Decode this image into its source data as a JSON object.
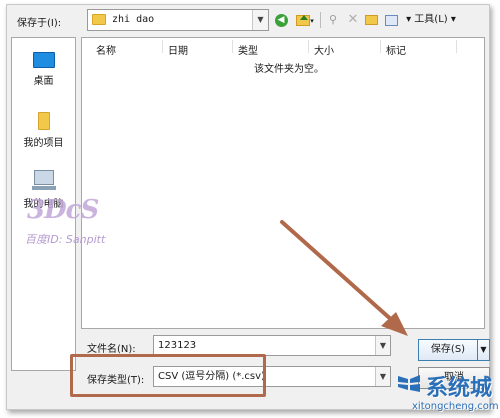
{
  "dialog": {
    "save_in_label": "保存于(I):",
    "folder_name": "zhi dao",
    "toolbar": {
      "tools_label": "▾ 工具(L) ▾"
    }
  },
  "places": [
    {
      "label": "桌面",
      "icon": "desktop-icon"
    },
    {
      "label": "我的项目",
      "icon": "folder-icon"
    },
    {
      "label": "我的电脑",
      "icon": "computer-icon"
    }
  ],
  "file_list": {
    "columns": [
      "名称",
      "日期",
      "类型",
      "大小",
      "标记"
    ],
    "empty_message": "该文件夹为空。"
  },
  "form": {
    "filename_label": "文件名(N):",
    "filename_value": "123123",
    "filetype_label": "保存类型(T):",
    "filetype_value": "CSV (逗号分隔) (*.csv)"
  },
  "buttons": {
    "save": "保存(S)",
    "cancel": "取消"
  },
  "watermarks": {
    "overlay_logo": "3DcS",
    "overlay_text": "百度ID: Sanpitt",
    "site_brand": "系统城",
    "site_url": "xitongcheng.com"
  },
  "colors": {
    "annotation": "#b0694a",
    "accent": "#3c7fb1"
  }
}
